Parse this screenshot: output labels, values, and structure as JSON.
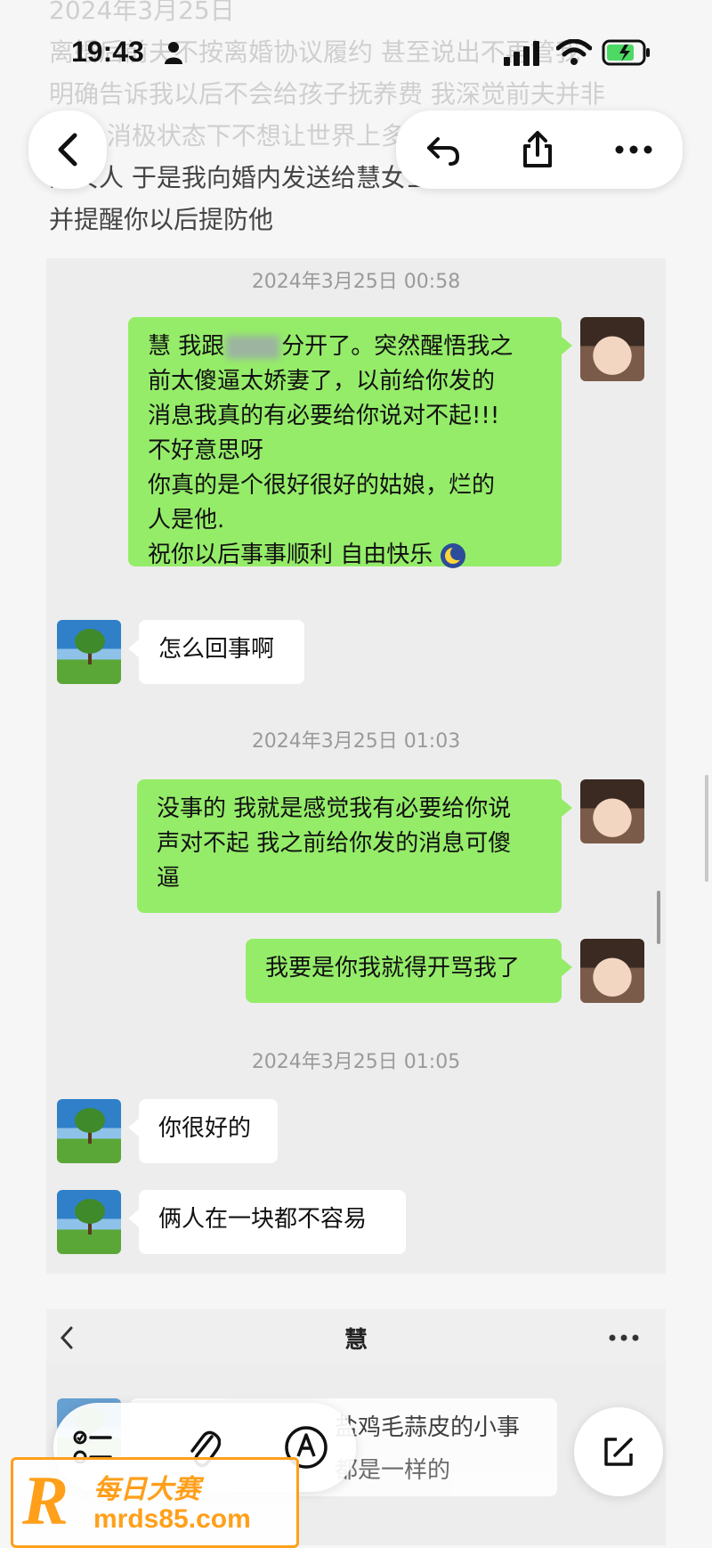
{
  "status_bar": {
    "time": "19:43"
  },
  "note": {
    "date_faded": "2024年3月25日",
    "line1": "离婚后前夫不按离婚协议履约 甚至说出不再管我",
    "line2": "明确告诉我以后不会给孩子抚养费 我深觉前夫并非",
    "line3": "良人 消极状态下不想让世界上多一个第二个受害",
    "line4": "的女人 于是我向婚内发送给慧女士的短信内容道歉",
    "line5": "并提醒你以后提防他"
  },
  "chat": {
    "timestamps": [
      "2024年3月25日 00:58",
      "2024年3月25日 01:03",
      "2024年3月25日 01:05"
    ],
    "msg1": {
      "line1": "慧 我跟",
      "line1_tail": "分开了。突然醒悟我之",
      "line2": "前太傻逼太娇妻了，以前给你发的",
      "line3": "消息我真的有必要给你说对不起!!!",
      "line4": "不好意思呀",
      "line5": "你真的是个很好很好的姑娘，烂的",
      "line6": "人是他.",
      "line7": "祝你以后事事顺利 自由快乐"
    },
    "msg2": "怎么回事啊",
    "msg3": {
      "line1": "没事的 我就是感觉我有必要给你说",
      "line2": "声对不起 我之前给你发的消息可傻",
      "line3": "逼"
    },
    "msg4": "我要是你我就得开骂我了",
    "msg5": "你很好的",
    "msg6": "俩人在一块都不容易"
  },
  "second_chat": {
    "title": "慧",
    "partial_line1": "盐鸡毛蒜皮的小事",
    "partial_line2": "都是一样的"
  },
  "watermark": {
    "brand": "每日大赛",
    "url": "mrds85.com"
  },
  "colors": {
    "bubble_green": "#95ec69",
    "bubble_white": "#ffffff",
    "panel_bg": "#ededed",
    "watermark_orange": "#ff9f1a"
  },
  "icons": [
    "back-arrow-icon",
    "undo-icon",
    "share-icon",
    "more-icon",
    "checklist-icon",
    "paperclip-icon",
    "pen-icon",
    "compose-icon",
    "moon-emoji-icon"
  ]
}
